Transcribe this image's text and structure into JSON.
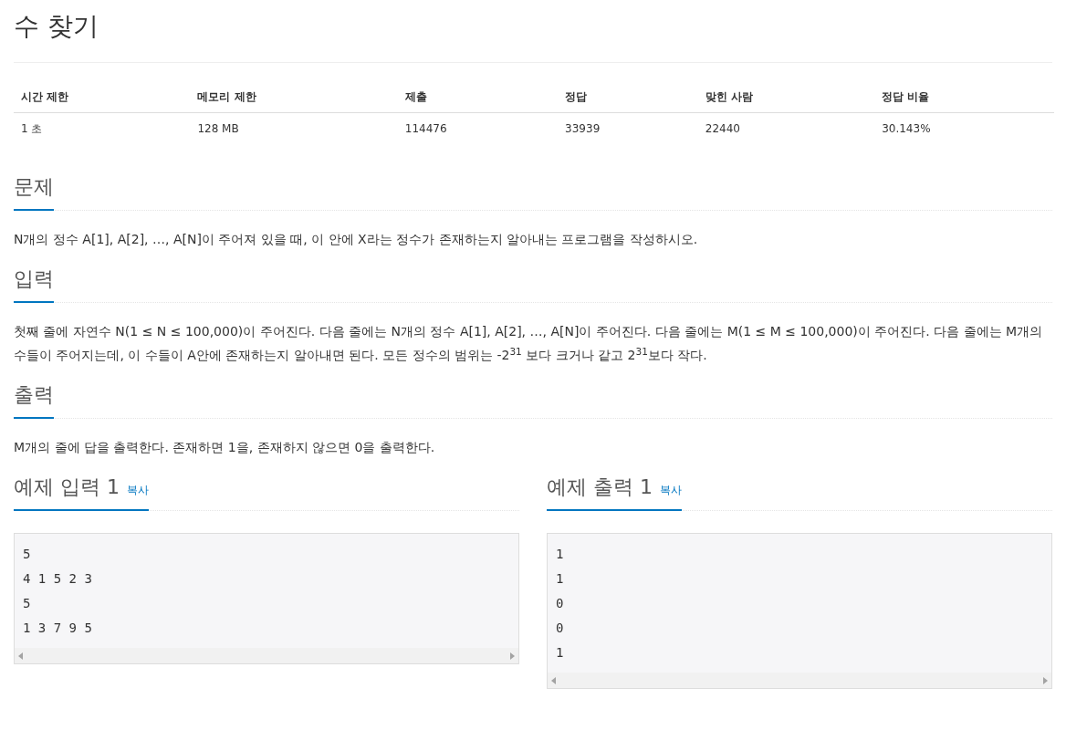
{
  "title": "수 찾기",
  "stats_table": {
    "columns": [
      "시간 제한",
      "메모리 제한",
      "제출",
      "정답",
      "맞힌 사람",
      "정답 비율"
    ],
    "rows": [
      [
        "1 초",
        "128 MB",
        "114476",
        "33939",
        "22440",
        "30.143%"
      ]
    ]
  },
  "sections": [
    {
      "heading": "문제",
      "body": "N개의 정수 A[1], A[2], …, A[N]이 주어져 있을 때, 이 안에 X라는 정수가 존재하는지 알아내는 프로그램을 작성하시오."
    },
    {
      "heading": "입력",
      "body": "첫째 줄에 자연수 N(1 ≤ N ≤ 100,000)이 주어진다. 다음 줄에는 N개의 정수 A[1], A[2], …, A[N]이 주어진다. 다음 줄에는 M(1 ≤ M ≤ 100,000)이 주어진다. 다음 줄에는 M개의 수들이 주어지는데, 이 수들이 A안에 존재하는지 알아내면 된다. 모든 정수의 범위는 -2$^{31}$ 보다 크거나 같고 2$^{31}$보다 작다."
    },
    {
      "heading": "출력",
      "body": "M개의 줄에 답을 출력한다. 존재하면 1을, 존재하지 않으면 0을 출력한다."
    }
  ],
  "samples": [
    {
      "heading": "예제 입력 1",
      "copy_link": "복사",
      "lines": [
        "5",
        "4 1 5 2 3",
        "5",
        "1 3 7 9 5"
      ]
    },
    {
      "heading": "예제 출력 1",
      "copy_link": "복사",
      "lines": [
        "1",
        "1",
        "0",
        "0",
        "1"
      ]
    }
  ]
}
